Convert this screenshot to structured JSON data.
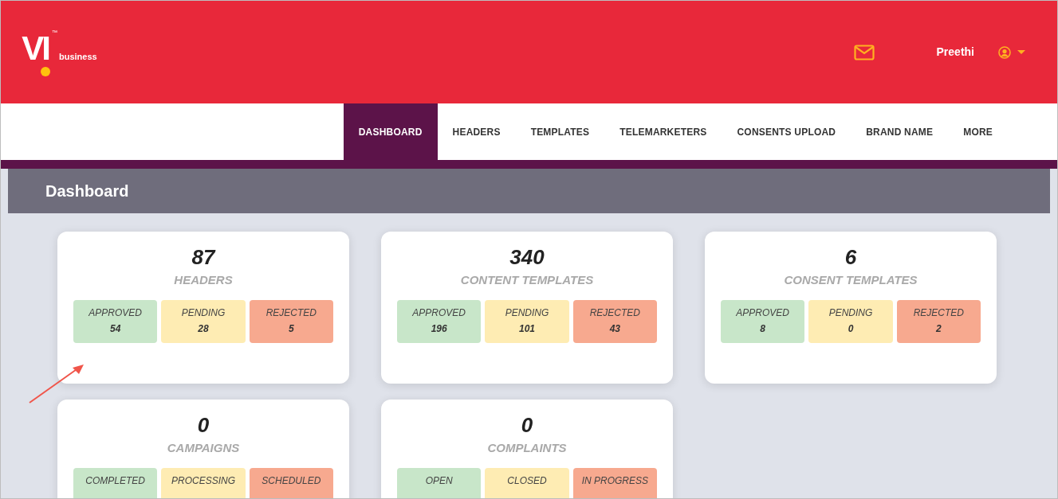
{
  "header": {
    "logo_mark": "VI",
    "logo_tm": "™",
    "logo_sub": "business",
    "user": "Preethi"
  },
  "nav": [
    {
      "label": "DASHBOARD",
      "selected": true
    },
    {
      "label": "HEADERS",
      "selected": false
    },
    {
      "label": "TEMPLATES",
      "selected": false
    },
    {
      "label": "TELEMARKETERS",
      "selected": false
    },
    {
      "label": "CONSENTS UPLOAD",
      "selected": false
    },
    {
      "label": "BRAND NAME",
      "selected": false
    },
    {
      "label": "MORE",
      "selected": false
    }
  ],
  "page_title": "Dashboard",
  "cards": [
    {
      "total": "87",
      "title": "HEADERS",
      "stats": [
        {
          "label": "APPROVED",
          "count": "54",
          "color": "#c8e6c9"
        },
        {
          "label": "PENDING",
          "count": "28",
          "color": "#feecb3"
        },
        {
          "label": "REJECTED",
          "count": "5",
          "color": "#f7a98f"
        }
      ]
    },
    {
      "total": "340",
      "title": "CONTENT TEMPLATES",
      "stats": [
        {
          "label": "APPROVED",
          "count": "196",
          "color": "#c8e6c9"
        },
        {
          "label": "PENDING",
          "count": "101",
          "color": "#feecb3"
        },
        {
          "label": "REJECTED",
          "count": "43",
          "color": "#f7a98f"
        }
      ]
    },
    {
      "total": "6",
      "title": "CONSENT TEMPLATES",
      "stats": [
        {
          "label": "APPROVED",
          "count": "8",
          "color": "#c8e6c9"
        },
        {
          "label": "PENDING",
          "count": "0",
          "color": "#feecb3"
        },
        {
          "label": "REJECTED",
          "count": "2",
          "color": "#f7a98f"
        }
      ]
    },
    {
      "total": "0",
      "title": "CAMPAIGNS",
      "stats": [
        {
          "label": "COMPLETED",
          "color": "#c8e6c9"
        },
        {
          "label": "PROCESSING",
          "color": "#feecb3"
        },
        {
          "label": "SCHEDULED",
          "color": "#f7a98f"
        }
      ]
    },
    {
      "total": "0",
      "title": "COMPLAINTS",
      "stats": [
        {
          "label": "OPEN",
          "color": "#c8e6c9"
        },
        {
          "label": "CLOSED",
          "color": "#feecb3"
        },
        {
          "label": "IN PROGRESS",
          "color": "#f7a98f"
        }
      ]
    }
  ]
}
